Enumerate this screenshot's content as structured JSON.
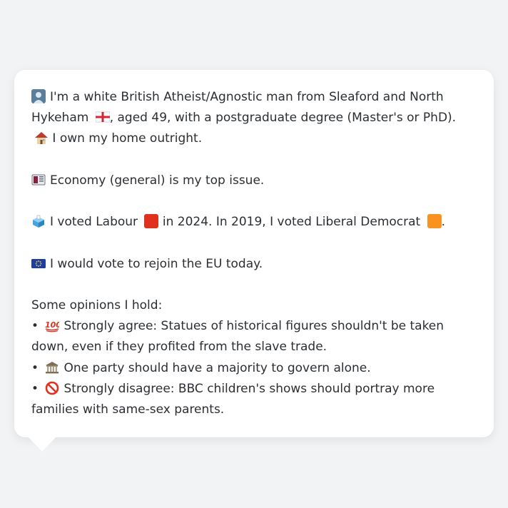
{
  "profile": {
    "line1_text": "I'm a white British Atheist/Agnostic man from Sleaford and North Hykeham",
    "line1_tail": ", aged 49, with a postgraduate degree (Master's or PhD).",
    "home_text": "I own my home outright.",
    "issue_text": "Economy (general) is my top issue.",
    "vote_part1": "I voted Labour",
    "vote_part2": "in 2024. In 2019, I voted Liberal Democrat",
    "vote_part3": ".",
    "eu_text": "I would vote to rejoin the EU today.",
    "opinions_heading": "Some opinions I hold:",
    "opinions": [
      {
        "bullet": "•",
        "icon": "hundred-points-icon",
        "text": "Strongly agree: Statues of historical figures shouldn't be taken down, even if they profited from the slave trade."
      },
      {
        "bullet": "•",
        "icon": "classical-building-icon",
        "text": "One party should have a majority to govern alone."
      },
      {
        "bullet": "•",
        "icon": "prohibited-icon",
        "text": "Strongly disagree: BBC children's shows should portray more families with same-sex parents."
      }
    ]
  },
  "colors": {
    "labour": "#e0301e",
    "libdem": "#f7931e",
    "background": "#f1f3f5",
    "card": "#ffffff",
    "text": "#2b2f33"
  },
  "icons": [
    "person-icon",
    "england-flag-icon",
    "house-icon",
    "newspaper-icon",
    "ballot-box-icon",
    "eu-flag-icon",
    "hundred-points-icon",
    "classical-building-icon",
    "prohibited-icon"
  ]
}
